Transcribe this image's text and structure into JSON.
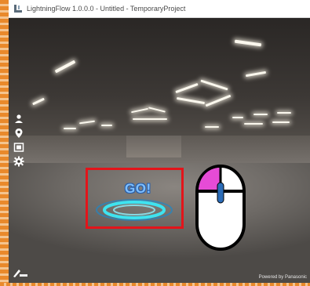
{
  "window": {
    "title": "LightningFlow 1.0.0.0 - Untitled - TemporaryProject"
  },
  "viewport": {
    "go_label": "GO!",
    "powered_by": "Powered by Panasonic",
    "edit_label": "Edit"
  },
  "toolbar": {
    "items": [
      "person-pin-icon",
      "location-pin-icon",
      "frame-icon",
      "gear-icon"
    ]
  },
  "colors": {
    "border_accent": "#e9892b",
    "highlight_box": "#e3141a",
    "mouse_left_button": "#e64bd6",
    "go_text": "#7fc0ff",
    "ring": "#3ee3f0"
  }
}
